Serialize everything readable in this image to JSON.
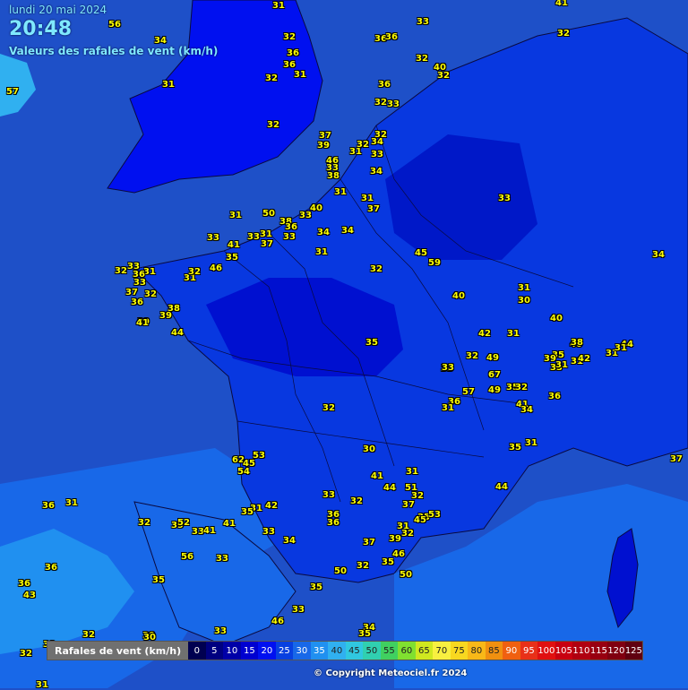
{
  "header": {
    "date": "lundi 20 mai 2024",
    "time": "20:48",
    "subtitle": "Valeurs des rafales de vent (km/h)"
  },
  "legend": {
    "title": "Rafales de vent (km/h)",
    "steps": [
      {
        "label": "0",
        "color": "#000050"
      },
      {
        "label": "5",
        "color": "#000080"
      },
      {
        "label": "10",
        "color": "#0000a8"
      },
      {
        "label": "15",
        "color": "#0000d0"
      },
      {
        "label": "20",
        "color": "#0010f0"
      },
      {
        "label": "25",
        "color": "#0840e0"
      },
      {
        "label": "30",
        "color": "#1868e8"
      },
      {
        "label": "35",
        "color": "#2090f0"
      },
      {
        "label": "40",
        "color": "#30b0f0"
      },
      {
        "label": "45",
        "color": "#30c8e0"
      },
      {
        "label": "50",
        "color": "#30d0b0"
      },
      {
        "label": "55",
        "color": "#40d060"
      },
      {
        "label": "60",
        "color": "#80e030"
      },
      {
        "label": "65",
        "color": "#d0e820"
      },
      {
        "label": "70",
        "color": "#f8f040"
      },
      {
        "label": "75",
        "color": "#f8d820"
      },
      {
        "label": "80",
        "color": "#f8b818"
      },
      {
        "label": "85",
        "color": "#f09010"
      },
      {
        "label": "90",
        "color": "#f06010"
      },
      {
        "label": "95",
        "color": "#e83018"
      },
      {
        "label": "100",
        "color": "#e01010"
      },
      {
        "label": "105",
        "color": "#c80010"
      },
      {
        "label": "110",
        "color": "#b00010"
      },
      {
        "label": "115",
        "color": "#980010"
      },
      {
        "label": "120",
        "color": "#800010"
      },
      {
        "label": "125",
        "color": "#600010"
      }
    ]
  },
  "copyright": "© Copyright Meteociel.fr 2024",
  "colors": {
    "sea_deep": "#1e50c8",
    "zone_30": "#1868e8",
    "zone_25": "#0838e0",
    "zone_20": "#0018e8",
    "zone_15": "#0000d0",
    "zone_35": "#2090f0",
    "coast": "#0a0a40",
    "value_text": "#ffff00"
  },
  "stations": [
    {
      "v": "31"
    },
    {
      "v": "41"
    },
    {
      "v": "56"
    },
    {
      "v": "34"
    },
    {
      "v": "32"
    },
    {
      "v": "36"
    },
    {
      "v": "36"
    },
    {
      "v": "33"
    },
    {
      "v": "36"
    },
    {
      "v": "32"
    },
    {
      "v": "40"
    },
    {
      "v": "32"
    },
    {
      "v": "31"
    },
    {
      "v": "31"
    },
    {
      "v": "36"
    },
    {
      "v": "32"
    },
    {
      "v": "32"
    },
    {
      "v": "33"
    },
    {
      "v": "57"
    },
    {
      "v": "36"
    },
    {
      "v": "32"
    },
    {
      "v": "37"
    },
    {
      "v": "32"
    },
    {
      "v": "39"
    },
    {
      "v": "34"
    },
    {
      "v": "32"
    },
    {
      "v": "31"
    },
    {
      "v": "46"
    },
    {
      "v": "33"
    },
    {
      "v": "33"
    },
    {
      "v": "38"
    },
    {
      "v": "34"
    },
    {
      "v": "32"
    },
    {
      "v": "31"
    },
    {
      "v": "40"
    },
    {
      "v": "37"
    },
    {
      "v": "31"
    },
    {
      "v": "33"
    },
    {
      "v": "50"
    },
    {
      "v": "38"
    },
    {
      "v": "36"
    },
    {
      "v": "33"
    },
    {
      "v": "31"
    },
    {
      "v": "33"
    },
    {
      "v": "34"
    },
    {
      "v": "34"
    },
    {
      "v": "41"
    },
    {
      "v": "37"
    },
    {
      "v": "33"
    },
    {
      "v": "31"
    },
    {
      "v": "45"
    },
    {
      "v": "35"
    },
    {
      "v": "59"
    },
    {
      "v": "31"
    },
    {
      "v": "46"
    },
    {
      "v": "32"
    },
    {
      "v": "33"
    },
    {
      "v": "32"
    },
    {
      "v": "32"
    },
    {
      "v": "39"
    },
    {
      "v": "36"
    },
    {
      "v": "31"
    },
    {
      "v": "31"
    },
    {
      "v": "33"
    },
    {
      "v": "32"
    },
    {
      "v": "37"
    },
    {
      "v": "36"
    },
    {
      "v": "40"
    },
    {
      "v": "31"
    },
    {
      "v": "30"
    },
    {
      "v": "38"
    },
    {
      "v": "39"
    },
    {
      "v": "40"
    },
    {
      "v": "41"
    },
    {
      "v": "44"
    },
    {
      "v": "34"
    },
    {
      "v": "33"
    },
    {
      "v": "42"
    },
    {
      "v": "31"
    },
    {
      "v": "35"
    },
    {
      "v": "33"
    },
    {
      "v": "49"
    },
    {
      "v": "40"
    },
    {
      "v": "35"
    },
    {
      "v": "39"
    },
    {
      "v": "31"
    },
    {
      "v": "44"
    },
    {
      "v": "31"
    },
    {
      "v": "31"
    },
    {
      "v": "32"
    },
    {
      "v": "33"
    },
    {
      "v": "67"
    },
    {
      "v": "38"
    },
    {
      "v": "42"
    },
    {
      "v": "33"
    },
    {
      "v": "57"
    },
    {
      "v": "49"
    },
    {
      "v": "35"
    },
    {
      "v": "32"
    },
    {
      "v": "36"
    },
    {
      "v": "36"
    },
    {
      "v": "31"
    },
    {
      "v": "41"
    },
    {
      "v": "34"
    },
    {
      "v": "32"
    },
    {
      "v": "35"
    },
    {
      "v": "31"
    },
    {
      "v": "30"
    },
    {
      "v": "62"
    },
    {
      "v": "45"
    },
    {
      "v": "53"
    },
    {
      "v": "54"
    },
    {
      "v": "41"
    },
    {
      "v": "31"
    },
    {
      "v": "44"
    },
    {
      "v": "51"
    },
    {
      "v": "44"
    },
    {
      "v": "33"
    },
    {
      "v": "32"
    },
    {
      "v": "32"
    },
    {
      "v": "37"
    },
    {
      "v": "35"
    },
    {
      "v": "53"
    },
    {
      "v": "45"
    },
    {
      "v": "36"
    },
    {
      "v": "31"
    },
    {
      "v": "36"
    },
    {
      "v": "31"
    },
    {
      "v": "42"
    },
    {
      "v": "35"
    },
    {
      "v": "36"
    },
    {
      "v": "31"
    },
    {
      "v": "39"
    },
    {
      "v": "32"
    },
    {
      "v": "52"
    },
    {
      "v": "33"
    },
    {
      "v": "41"
    },
    {
      "v": "33"
    },
    {
      "v": "34"
    },
    {
      "v": "32"
    },
    {
      "v": "37"
    },
    {
      "v": "39"
    },
    {
      "v": "41"
    },
    {
      "v": "56"
    },
    {
      "v": "33"
    },
    {
      "v": "46"
    },
    {
      "v": "35"
    },
    {
      "v": "35"
    },
    {
      "v": "50"
    },
    {
      "v": "32"
    },
    {
      "v": "50"
    },
    {
      "v": "43"
    },
    {
      "v": "36"
    },
    {
      "v": "36"
    },
    {
      "v": "35"
    },
    {
      "v": "46"
    },
    {
      "v": "33"
    },
    {
      "v": "34"
    },
    {
      "v": "35"
    },
    {
      "v": "30"
    },
    {
      "v": "32"
    },
    {
      "v": "32"
    },
    {
      "v": "33"
    },
    {
      "v": "30"
    },
    {
      "v": "39"
    },
    {
      "v": "31"
    },
    {
      "v": "37"
    },
    {
      "v": "31"
    }
  ]
}
